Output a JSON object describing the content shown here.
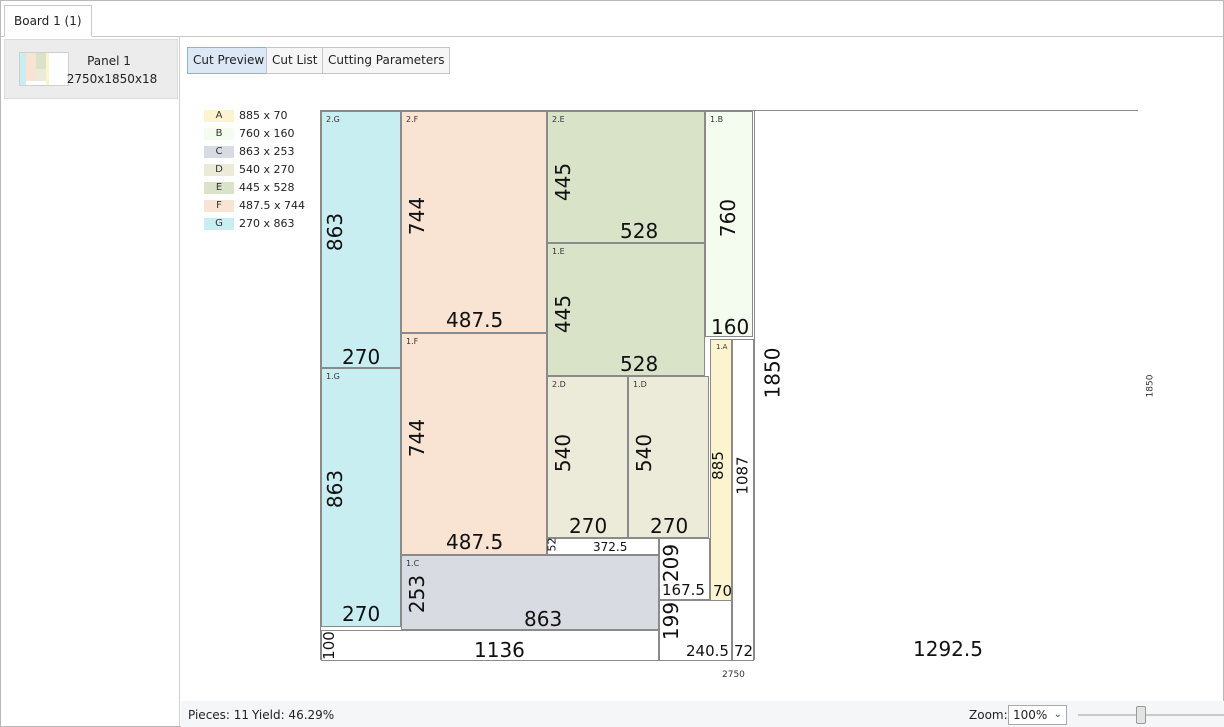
{
  "tabs": [
    {
      "label": "Board 1 (1)"
    }
  ],
  "sidebar": {
    "panel": {
      "name": "Panel 1",
      "dims": "2750x1850x18"
    }
  },
  "toolbar": {
    "cut_preview": "Cut Preview",
    "cut_list": "Cut List",
    "cutting_parameters": "Cutting Parameters"
  },
  "colors": {
    "A": "#fbf4cf",
    "B": "#f4fbef",
    "C": "#d9dbe3",
    "D": "#ecebd9",
    "E": "#d8e3c8",
    "F": "#f9e3d2",
    "G": "#c9eef2",
    "waste": "#ffffff",
    "active_button": "#dce8f6"
  },
  "legend": [
    {
      "id": "A",
      "text": "885 x 70"
    },
    {
      "id": "B",
      "text": "760 x 160"
    },
    {
      "id": "C",
      "text": "863 x 253"
    },
    {
      "id": "D",
      "text": "540 x 270"
    },
    {
      "id": "E",
      "text": "445 x 528"
    },
    {
      "id": "F",
      "text": "487.5 x 744"
    },
    {
      "id": "G",
      "text": "270 x 863"
    }
  ],
  "board": {
    "width_label": "2750",
    "height_label": "1850"
  },
  "pieces": [
    {
      "tag": "2.G",
      "type": "G",
      "w": "270",
      "h": "863"
    },
    {
      "tag": "1.G",
      "type": "G",
      "w": "270",
      "h": "863"
    },
    {
      "tag": "2.F",
      "type": "F",
      "w": "487.5",
      "h": "744"
    },
    {
      "tag": "1.F",
      "type": "F",
      "w": "487.5",
      "h": "744"
    },
    {
      "tag": "2.E",
      "type": "E",
      "w": "528",
      "h": "445"
    },
    {
      "tag": "1.E",
      "type": "E",
      "w": "528",
      "h": "445"
    },
    {
      "tag": "2.D",
      "type": "D",
      "w": "270",
      "h": "540"
    },
    {
      "tag": "1.D",
      "type": "D",
      "w": "270",
      "h": "540"
    },
    {
      "tag": "1.C",
      "type": "C",
      "w": "863",
      "h": "253"
    },
    {
      "tag": "1.B",
      "type": "B",
      "w": "160",
      "h": "760"
    },
    {
      "tag": "1.A",
      "type": "A",
      "w": "70",
      "h": "885"
    }
  ],
  "waste": [
    {
      "w": "1292.5",
      "h": "1850"
    },
    {
      "w": "1136",
      "h": "100"
    },
    {
      "w": "372.5",
      "h": "52"
    },
    {
      "w": "167.5",
      "h": "209"
    },
    {
      "w": "240.5",
      "h": "199"
    },
    {
      "w": "72",
      "h": "1087"
    }
  ],
  "status": {
    "pieces": "Pieces: 11",
    "yield": "Yield: 46.29%",
    "zoom_label": "Zoom:",
    "zoom_value": "100%"
  }
}
